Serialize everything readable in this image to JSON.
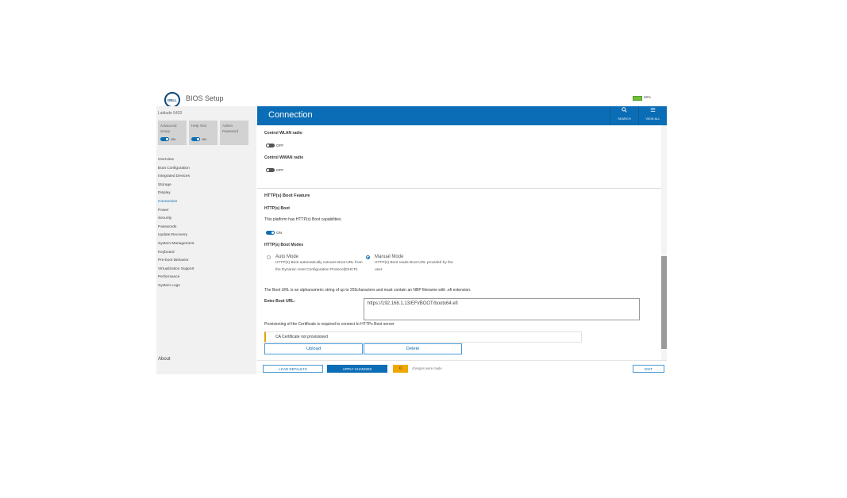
{
  "app": {
    "logo_text": "DELL",
    "title": "BIOS Setup",
    "battery_percent": "98%",
    "model": "Latitude 5420"
  },
  "quick_tiles": [
    {
      "label": "Advanced Setup",
      "toggle_state": "ON"
    },
    {
      "label": "Help Text",
      "toggle_state": "ON"
    },
    {
      "label": "Admin Password"
    }
  ],
  "nav": {
    "items": [
      "Overview",
      "Boot Configuration",
      "Integrated Devices",
      "Storage",
      "Display",
      "Connection",
      "Power",
      "Security",
      "Passwords",
      "Update,Recovery",
      "System Management",
      "Keyboard",
      "Pre-boot Behavior",
      "Virtualization Support",
      "Performance",
      "System Logs"
    ],
    "active": "Connection",
    "about": "About"
  },
  "header": {
    "title": "Connection",
    "search_label": "SEARCH",
    "search_icon": "search-icon",
    "view_all_label": "VIEW ALL",
    "view_all_icon": "list-icon"
  },
  "content": {
    "wlan": {
      "label": "Control WLAN radio",
      "state": "OFF"
    },
    "wwan": {
      "label": "Control WWAN radio",
      "state": "OFF"
    },
    "section_title": "HTTP(s) Boot Feature",
    "http_boot": {
      "label": "HTTP(s) Boot",
      "description": "This platform has HTTP(s) Boot capabilities.",
      "state": "ON"
    },
    "modes": {
      "label": "HTTP(s) Boot Modes",
      "auto": {
        "title": "Auto Mode",
        "desc": "HTTP(s) Boot automatically extracts Boot URL from the Dynamic Host Configuration Protocol(DHCP)",
        "selected": false
      },
      "manual": {
        "title": "Manual Mode",
        "desc": "HTTP(s) Boot reads Boot URL provided by the user",
        "selected": true
      }
    },
    "url_note": "The Boot URL is an alphanumeric string of up to 255characters and must contain an NBP filename with .efi extension.",
    "url_label": "Enter Boot URL:",
    "url_value": "https://192.168.1.13/EFI/BOOT/bootx64.efi",
    "cert_note": "Provisioning of the Certificate is required to connect to HTTPs Boot server",
    "cert_status": "CA Certificate not provisioned",
    "upload_label": "Upload",
    "delete_label": "Delete"
  },
  "footer": {
    "load_defaults": "LOAD DEFAULTS",
    "apply_changes": "APPLY CHANGES",
    "changes_count": "0",
    "changes_text": "changes were made",
    "exit": "EXIT"
  },
  "colors": {
    "accent": "#0b6db5",
    "warning": "#f0a800",
    "sidebar_bg": "#f1f1f1",
    "battery": "#6fbf3a"
  },
  "scrollbar": {
    "position_fraction": 0.56,
    "visible_fraction": 0.4
  }
}
